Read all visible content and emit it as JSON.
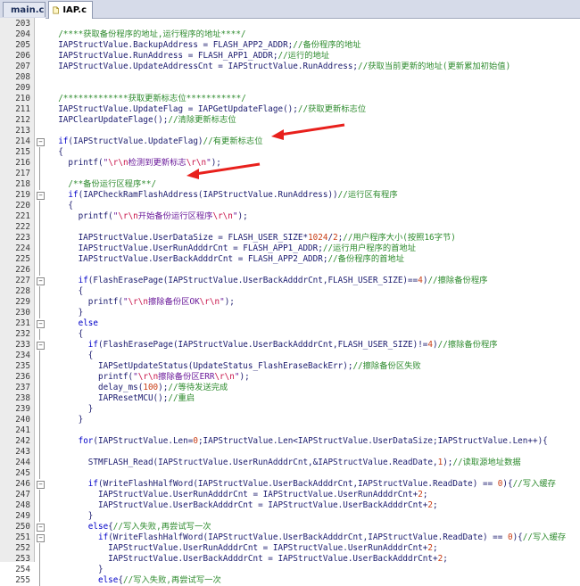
{
  "tabs": [
    {
      "label": "main.c",
      "active": false,
      "icon": "c-file-icon"
    },
    {
      "label": "IAP.c",
      "active": true,
      "icon": "c-file-icon"
    }
  ],
  "colors": {
    "comment": "#2e8b2e",
    "string": "#6a1a9a",
    "keyword": "#0000c8",
    "annotation_arrow": "#e8201c"
  },
  "lines": [
    {
      "n": "203",
      "t": ""
    },
    {
      "n": "204",
      "t": "  /****获取备份程序的地址,运行程序的地址****/"
    },
    {
      "n": "205",
      "t": "  IAPStructValue.BackupAddress = FLASH_APP2_ADDR;//备份程序的地址"
    },
    {
      "n": "206",
      "t": "  IAPStructValue.RunAddress = FLASH_APP1_ADDR;//运行的地址"
    },
    {
      "n": "207",
      "t": "  IAPStructValue.UpdateAddressCnt = IAPStructValue.RunAddress;//获取当前更新的地址(更新累加初始值)"
    },
    {
      "n": "208",
      "t": ""
    },
    {
      "n": "209",
      "t": ""
    },
    {
      "n": "210",
      "t": "  /*************获取更新标志位***********/"
    },
    {
      "n": "211",
      "t": "  IAPStructValue.UpdateFlag = IAPGetUpdateFlage();//获取更新标志位"
    },
    {
      "n": "212",
      "t": "  IAPClearUpdateFlage();//清除更新标志位"
    },
    {
      "n": "213",
      "t": ""
    },
    {
      "n": "214",
      "t": "  if(IAPStructValue.UpdateFlag)//有更新标志位"
    },
    {
      "n": "215",
      "t": "  {"
    },
    {
      "n": "216",
      "t": "    printf(\"\\r\\n检测到更新标志\\r\\n\");"
    },
    {
      "n": "217",
      "t": ""
    },
    {
      "n": "218",
      "t": "    /**备份运行区程序**/"
    },
    {
      "n": "219",
      "t": "    if(IAPCheckRamFlashAddress(IAPStructValue.RunAddress))//运行区有程序"
    },
    {
      "n": "220",
      "t": "    {"
    },
    {
      "n": "221",
      "t": "      printf(\"\\r\\n开始备份运行区程序\\r\\n\");"
    },
    {
      "n": "222",
      "t": ""
    },
    {
      "n": "223",
      "t": "      IAPStructValue.UserDataSize = FLASH_USER_SIZE*1024/2;//用户程序大小(按照16字节)"
    },
    {
      "n": "224",
      "t": "      IAPStructValue.UserRunAdddrCnt = FLASH_APP1_ADDR;//运行用户程序的首地址"
    },
    {
      "n": "225",
      "t": "      IAPStructValue.UserBackAdddrCnt = FLASH_APP2_ADDR;//备份程序的首地址"
    },
    {
      "n": "226",
      "t": ""
    },
    {
      "n": "227",
      "t": "      if(FlashErasePage(IAPStructValue.UserBackAdddrCnt,FLASH_USER_SIZE)==4)//擦除备份程序"
    },
    {
      "n": "228",
      "t": "      {"
    },
    {
      "n": "229",
      "t": "        printf(\"\\r\\n擦除备份区OK\\r\\n\");"
    },
    {
      "n": "230",
      "t": "      }"
    },
    {
      "n": "231",
      "t": "      else"
    },
    {
      "n": "232",
      "t": "      {"
    },
    {
      "n": "233",
      "t": "        if(FlashErasePage(IAPStructValue.UserBackAdddrCnt,FLASH_USER_SIZE)!=4)//擦除备份程序"
    },
    {
      "n": "234",
      "t": "        {"
    },
    {
      "n": "235",
      "t": "          IAPSetUpdateStatus(UpdateStatus_FlashEraseBackErr);//擦除备份区失败"
    },
    {
      "n": "236",
      "t": "          printf(\"\\r\\n擦除备份区ERR\\r\\n\");"
    },
    {
      "n": "237",
      "t": "          delay_ms(100);//等待发送完成"
    },
    {
      "n": "238",
      "t": "          IAPResetMCU();//重启"
    },
    {
      "n": "239",
      "t": "        }"
    },
    {
      "n": "240",
      "t": "      }"
    },
    {
      "n": "241",
      "t": ""
    },
    {
      "n": "242",
      "t": "      for(IAPStructValue.Len=0;IAPStructValue.Len<IAPStructValue.UserDataSize;IAPStructValue.Len++){"
    },
    {
      "n": "243",
      "t": ""
    },
    {
      "n": "244",
      "t": "        STMFLASH_Read(IAPStructValue.UserRunAdddrCnt,&IAPStructValue.ReadDate,1);//读取源地址数据"
    },
    {
      "n": "245",
      "t": ""
    },
    {
      "n": "246",
      "t": "        if(WriteFlashHalfWord(IAPStructValue.UserBackAdddrCnt,IAPStructValue.ReadDate) == 0){//写入缓存"
    },
    {
      "n": "247",
      "t": "          IAPStructValue.UserRunAdddrCnt = IAPStructValue.UserRunAdddrCnt+2;"
    },
    {
      "n": "248",
      "t": "          IAPStructValue.UserBackAdddrCnt = IAPStructValue.UserBackAdddrCnt+2;"
    },
    {
      "n": "249",
      "t": "        }"
    },
    {
      "n": "250",
      "t": "        else{//写入失败,再尝试写一次"
    },
    {
      "n": "251",
      "t": "          if(WriteFlashHalfWord(IAPStructValue.UserBackAdddrCnt,IAPStructValue.ReadDate) == 0){//写入缓存"
    },
    {
      "n": "252",
      "t": "            IAPStructValue.UserRunAdddrCnt = IAPStructValue.UserRunAdddrCnt+2;"
    },
    {
      "n": "253",
      "t": "            IAPStructValue.UserBackAdddrCnt = IAPStructValue.UserBackAdddrCnt+2;"
    },
    {
      "n": "254",
      "t": "          }"
    },
    {
      "n": "255",
      "t": "          else{//写入失败,再尝试写一次"
    }
  ]
}
